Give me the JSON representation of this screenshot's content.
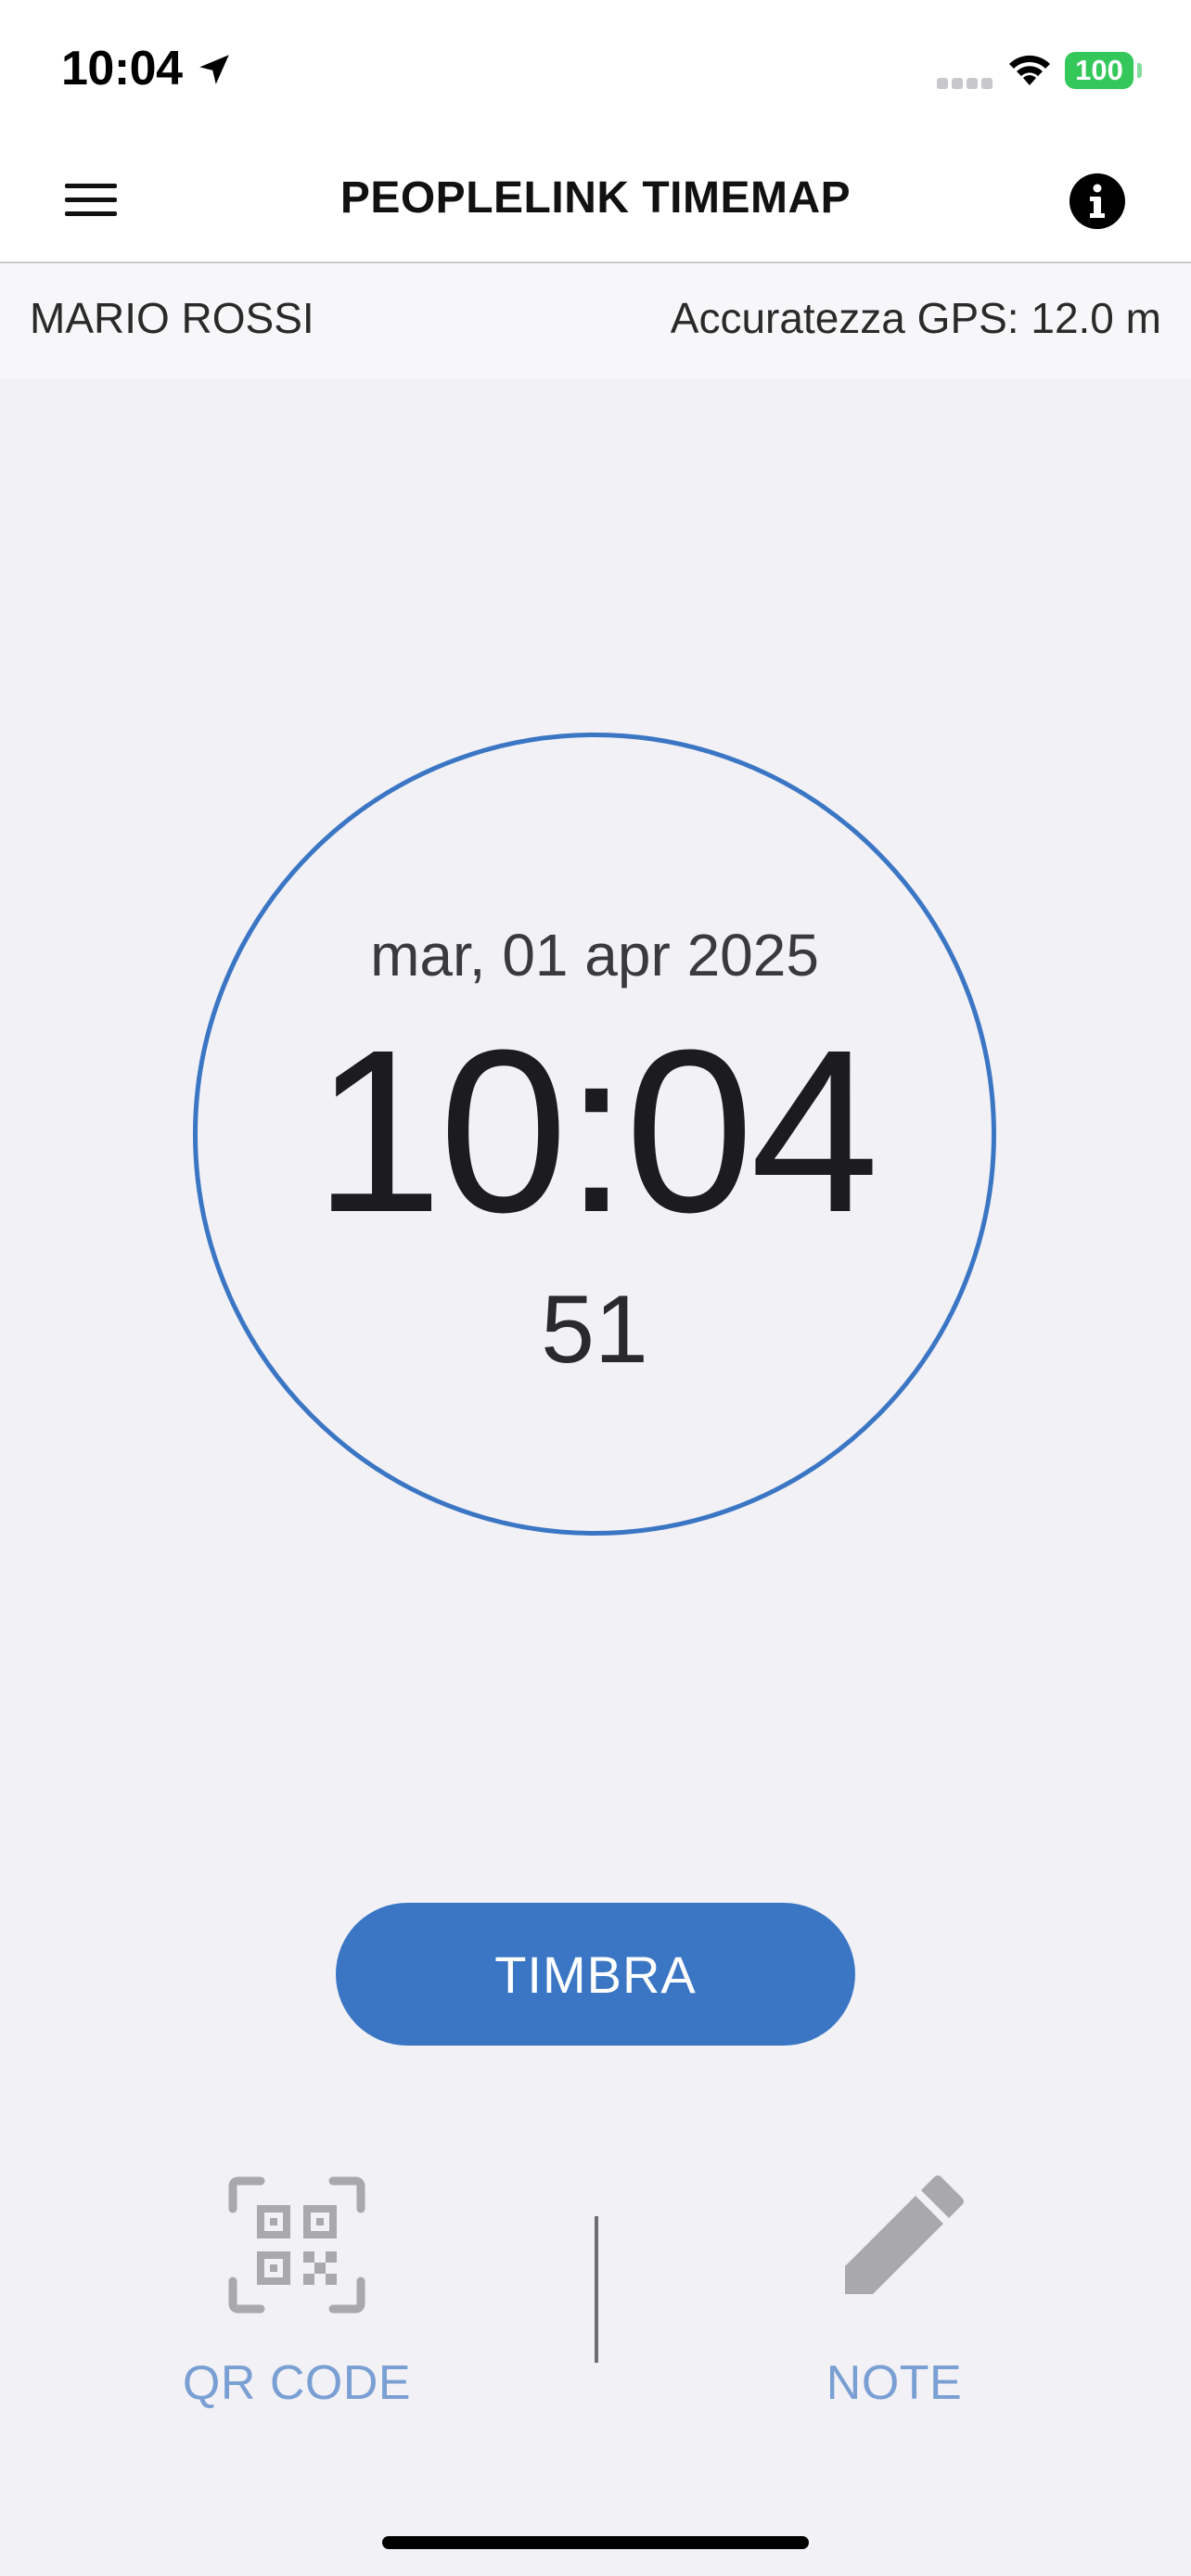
{
  "status_bar": {
    "time": "10:04",
    "battery": "100",
    "icons": [
      "location-arrow-icon",
      "cellular-signal-icon",
      "wifi-icon",
      "battery-icon"
    ]
  },
  "nav": {
    "title": "PEOPLELINK TIMEMAP",
    "left_icon": "hamburger-menu-icon",
    "right_icon": "info-icon"
  },
  "info_bar": {
    "user_name": "MARIO ROSSI",
    "gps_accuracy": "Accuratezza GPS: 12.0 m"
  },
  "clock": {
    "date": "mar, 01 apr 2025",
    "time": "10:04",
    "seconds": "51"
  },
  "actions": {
    "primary_label": "TIMBRA",
    "qr_label": "QR CODE",
    "qr_icon": "qr-code-icon",
    "note_label": "NOTE",
    "note_icon": "pencil-icon"
  },
  "colors": {
    "accent": "#3b76c4",
    "action_label": "#7a9fd3",
    "background": "#f1f1f6",
    "battery": "#34c759",
    "icon_gray": "#a9a9ab"
  }
}
